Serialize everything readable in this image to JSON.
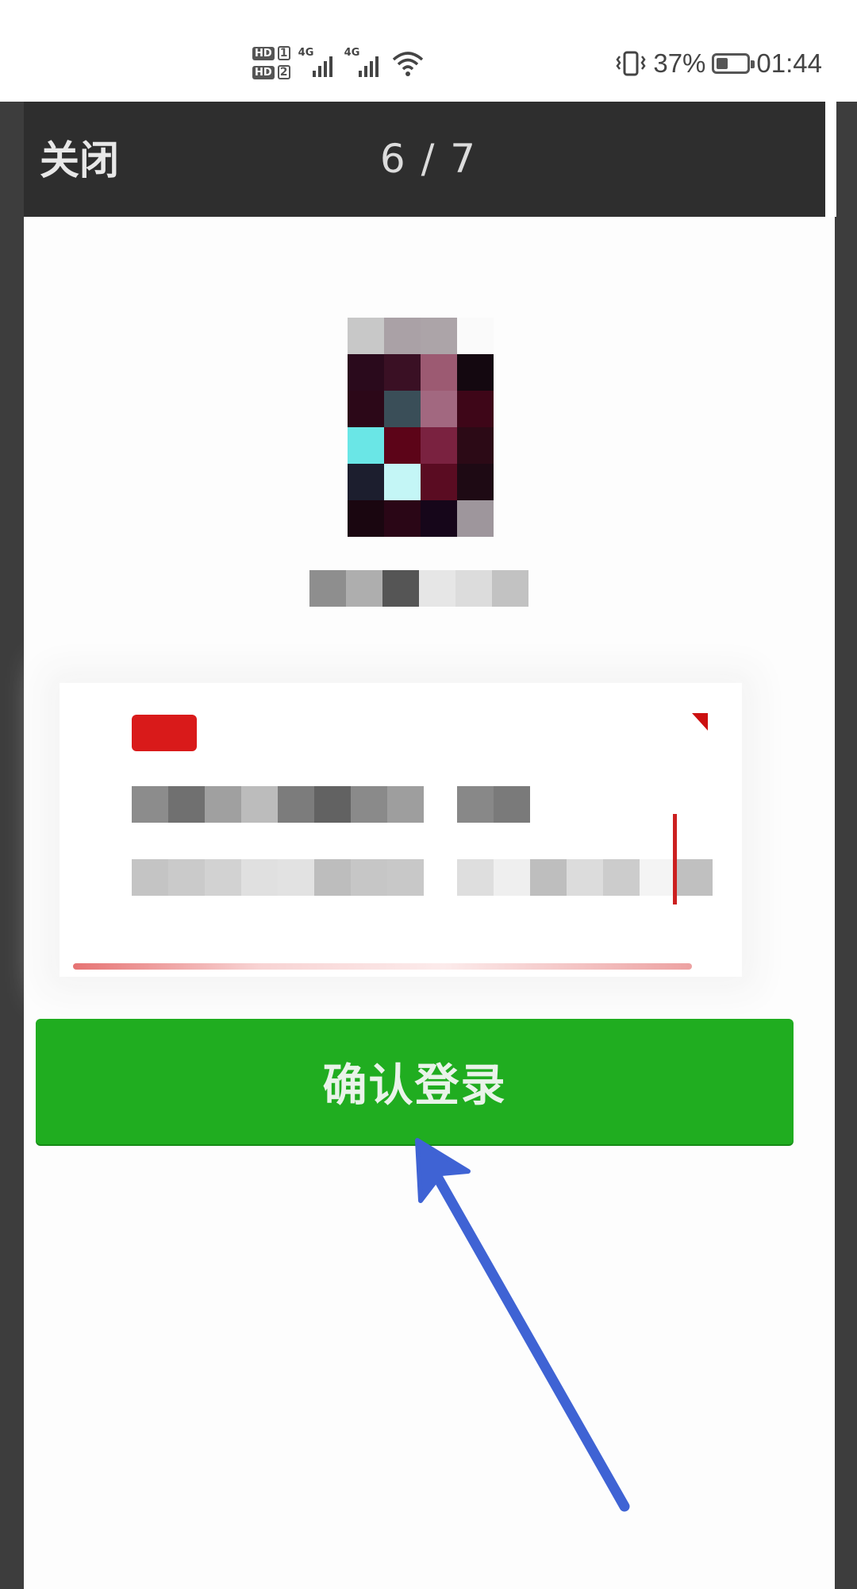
{
  "status_bar": {
    "sim1_label": "HD",
    "sim1_number": "1",
    "sim2_label": "HD",
    "sim2_number": "2",
    "network1": "4G",
    "network2": "4G",
    "battery_percent": "37%",
    "time": "01:44",
    "icons": [
      "hd-icon",
      "signal-icon",
      "signal-icon",
      "wifi-icon",
      "vibrate-icon",
      "battery-icon"
    ]
  },
  "header": {
    "close_label": "关闭",
    "page_indicator": "6 / 7",
    "background": "#2e2e2e"
  },
  "login": {
    "confirm_label": "确认登录",
    "button_color": "#20ad20"
  },
  "annotation": {
    "arrow_color": "#3f63d4",
    "arrow_icon": "pointer-arrow-icon"
  }
}
